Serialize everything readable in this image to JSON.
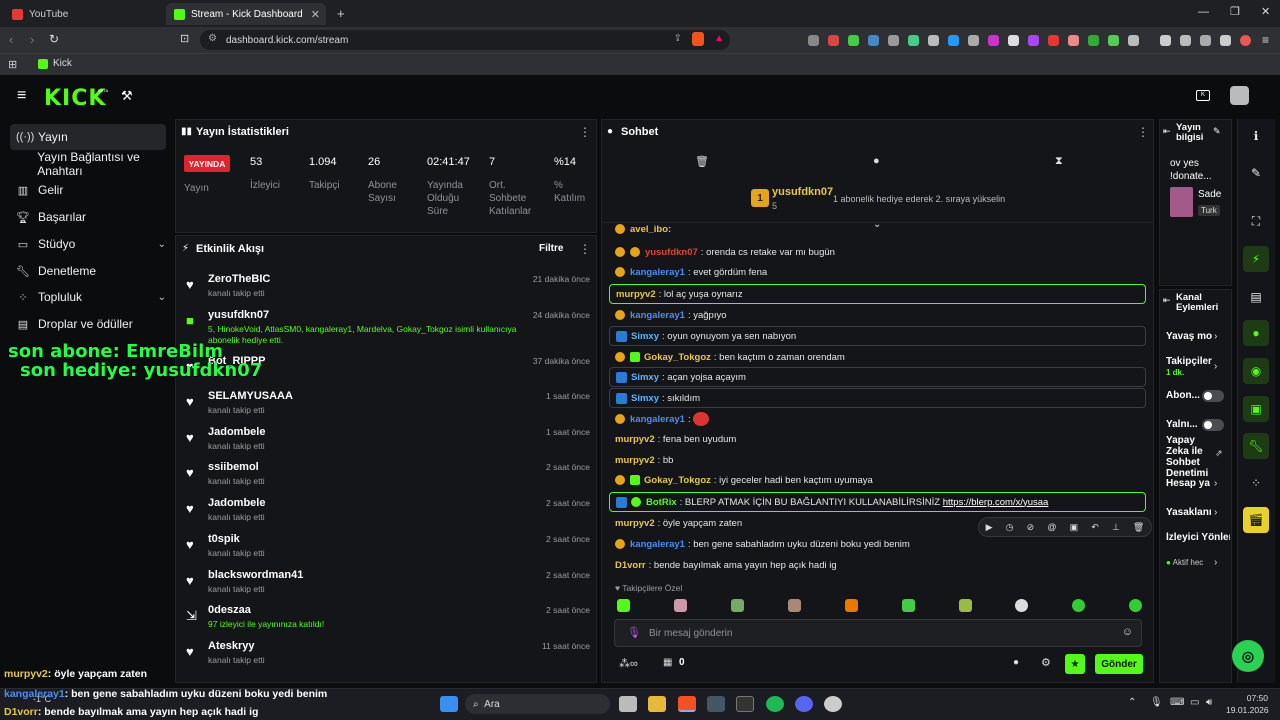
{
  "browser": {
    "tabs": [
      {
        "label": "YouTube"
      },
      {
        "label": "Stream - Kick Dashboard"
      }
    ],
    "url": "dashboard.kick.com/stream",
    "bookmark": "Kick"
  },
  "header": {
    "logo": "KICK",
    "logo_badge": "BETA"
  },
  "sidebar": {
    "items": [
      {
        "label": "Yayın",
        "icon": "broadcast-icon"
      },
      {
        "label": "Yayın Bağlantısı ve Anahtarı",
        "icon": ""
      },
      {
        "label": "Gelir",
        "icon": "chart-icon"
      },
      {
        "label": "Başarılar",
        "icon": "trophy-icon"
      },
      {
        "label": "Stüdyo",
        "icon": "studio-icon"
      },
      {
        "label": "Denetleme",
        "icon": "wrench-icon"
      },
      {
        "label": "Topluluk",
        "icon": "users-icon"
      },
      {
        "label": "Droplar ve ödüller",
        "icon": "gift-icon"
      }
    ]
  },
  "stats": {
    "title": "Yayın İstatistikleri",
    "live": "YAYINDA",
    "live_label": "Yayın",
    "columns": [
      {
        "value": "53",
        "label": "İzleyici"
      },
      {
        "value": "1.094",
        "label": "Takipçi"
      },
      {
        "value": "26",
        "label": "Abone Sayısı"
      },
      {
        "value": "02:41:47",
        "label": "Yayında Olduğu Süre"
      },
      {
        "value": "7",
        "label": "Ort. Sohbete Katılanlar"
      },
      {
        "value": "%14",
        "label": "% Katılım"
      }
    ]
  },
  "activity": {
    "title": "Etkinlik Akışı",
    "filter": "Filtre",
    "events": [
      {
        "name": "ZeroTheBIC",
        "sub": "kanalı takip etti",
        "time": "21 dakika önce"
      },
      {
        "name": "yusufdkn07",
        "sub": "5, HinokeVoid, AtlasSM0, kangaleray1, Mardelva, Gokay_Tokgoz isimli kullanıcıya abonelik hediye etti.",
        "time": "24 dakika önce"
      },
      {
        "name": "Bot_RIPPP",
        "sub": "",
        "time": "37 dakika önce"
      },
      {
        "name": "SELAMYUSAAA",
        "sub": "kanalı takip etti",
        "time": "1 saat önce"
      },
      {
        "name": "Jadombele",
        "sub": "kanalı takip etti",
        "time": "1 saat önce"
      },
      {
        "name": "ssiibemol",
        "sub": "kanalı takip etti",
        "time": "2 saat önce"
      },
      {
        "name": "Jadombele",
        "sub": "kanalı takip etti",
        "time": "2 saat önce"
      },
      {
        "name": "t0spik",
        "sub": "kanalı takip etti",
        "time": "2 saat önce"
      },
      {
        "name": "blackswordman41",
        "sub": "kanalı takip etti",
        "time": "2 saat önce"
      },
      {
        "name": "0deszaa",
        "sub": "97 izleyici ile yayınınıza katıldı!",
        "time": "2 saat önce"
      },
      {
        "name": "Ateskryy",
        "sub": "kanalı takip etti",
        "time": "11 saat önce"
      }
    ]
  },
  "overlay": {
    "line1": "son abone: EmreBilm",
    "line2": "son hediye: yusufdkn07"
  },
  "chat": {
    "title": "Sohbet",
    "pinned_user": "yusufdkn07",
    "pinned_count": "5",
    "pinned_rank": "1",
    "pinned_note": "1 abonelik hediye ederek 2. sıraya yükselin",
    "cut_user": "avel_ibo:",
    "messages": [
      {
        "user": "yusufdkn07",
        "text": "orenda cs retake var mı bugün",
        "color": "#e0443a"
      },
      {
        "user": "kangaleray1",
        "text": "evet gördüm fena",
        "color": "#4a8ff0"
      },
      {
        "user": "murpyv2",
        "text": "lol aç yuşa oynarız",
        "color": "#e8c74a"
      },
      {
        "user": "kangaleray1",
        "text": "yağpıyo",
        "color": "#4a8ff0"
      },
      {
        "user": "Simxy",
        "text": "oyun oynuyom ya sen nabıyon",
        "color": "#5ab4ff"
      },
      {
        "user": "Gokay_Tokgoz",
        "text": "ben kaçtım o zaman orendam",
        "color": "#e8c74a"
      },
      {
        "user": "Simxy",
        "text": "açan yojsa açayım",
        "color": "#5ab4ff"
      },
      {
        "user": "Simxy",
        "text": "sıkıldım",
        "color": "#5ab4ff"
      },
      {
        "user": "kangaleray1",
        "text": "",
        "color": "#4a8ff0"
      },
      {
        "user": "murpyv2",
        "text": "fena ben uyudum",
        "color": "#e8c74a"
      },
      {
        "user": "murpyv2",
        "text": "bb",
        "color": "#e8c74a"
      },
      {
        "user": "Gokay_Tokgoz",
        "text": "iyi geceler hadi ben kaçtım uyumaya",
        "color": "#e8c74a"
      },
      {
        "user": "BotRix",
        "text": "BLERP ATMAK İÇİN BU BAĞLANTIYI KULLANABİLİRSİNİZ",
        "link": "https://blerp.com/x/yusaa",
        "color": "#53fc18"
      },
      {
        "user": "murpyv2",
        "text": "öyle yapçam zaten",
        "color": "#e8c74a"
      },
      {
        "user": "kangaleray1",
        "text": "ben gene sabahladım uyku düzeni boku yedi benim",
        "color": "#4a8ff0"
      },
      {
        "user": "D1vorr",
        "text": "bende bayılmak ama yayın hep açık hadi ig",
        "color": "#e8c74a"
      }
    ],
    "followers_only": "Takipçilere Özel",
    "input_placeholder": "Bir mesaj gönderin",
    "count": "0",
    "send": "Gönder"
  },
  "channel": {
    "info_title": "Yayın bilgisi",
    "info_text": "ov yes !donate...",
    "info_name": "Sade",
    "info_tag": "Turk",
    "actions_title": "Kanal Eylemleri",
    "actions": [
      {
        "label": "Yavaş mo"
      },
      {
        "label": "Takipçiler",
        "sub": "1 dk."
      },
      {
        "label": "Abon..."
      },
      {
        "label": "Yalnı..."
      },
      {
        "label": "Yapay Zeka ile Sohbet Denetimi"
      },
      {
        "label": "Hesap ya"
      },
      {
        "label": "Yasaklanı"
      },
      {
        "label": "İzleyici Yönlen"
      },
      {
        "label": "Aktif hec"
      }
    ]
  },
  "bottom_overlay": {
    "l1_user": "murpyv2",
    "l1_text": ": öyle yapçam zaten",
    "l2_user": "kangaleray1",
    "l2_text": ": ben gene sabahladım uyku düzeni boku yedi benim",
    "l3_user": "D1vorr",
    "l3_text": ": bende bayılmak ama yayın hep açık hadi ig"
  },
  "taskbar": {
    "search": "Ara",
    "time": "07:50",
    "date": "19.01.2026",
    "weather": "-1°C"
  }
}
